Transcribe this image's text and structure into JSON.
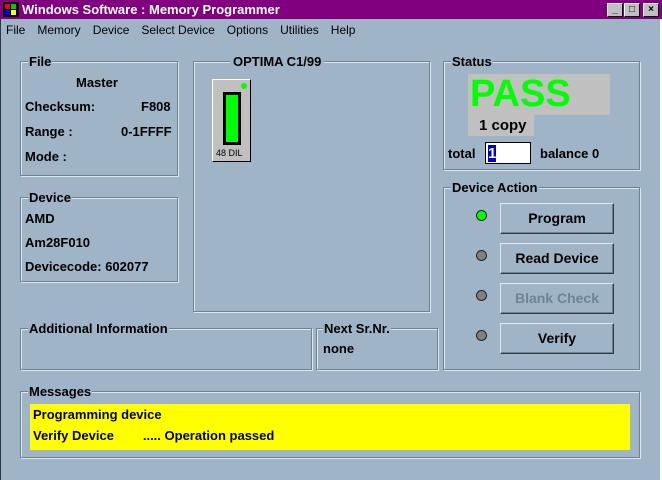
{
  "window": {
    "title": "Windows Software :  Memory Programmer",
    "minimize": "_",
    "maximize": "□",
    "close": "×"
  },
  "menu": [
    {
      "label": "File"
    },
    {
      "label": "Memory"
    },
    {
      "label": "Device"
    },
    {
      "label": "Select Device"
    },
    {
      "label": "Options"
    },
    {
      "label": "Utilities"
    },
    {
      "label": "Help"
    }
  ],
  "file": {
    "title": "File",
    "name": "Master",
    "checksum_label": "Checksum:",
    "checksum": "F808",
    "range_label": "Range :",
    "range": "0-1FFFF",
    "mode_label": "Mode :"
  },
  "device": {
    "title": "Device",
    "maker": "AMD",
    "part": "Am28F010",
    "devicecode": "Devicecode: 602077"
  },
  "programmer": {
    "title": "OPTIMA  C1/99",
    "socket": "48 DIL"
  },
  "additional": {
    "title": "Additional Information"
  },
  "next_sr": {
    "title": "Next Sr.Nr.",
    "value": "none"
  },
  "status": {
    "title": "Status",
    "result": "PASS",
    "copies": "1 copy",
    "total_label": "total",
    "total": "1",
    "balance": "balance 0",
    "pass_color": "#00ff00"
  },
  "actions": {
    "title": "Device Action",
    "buttons": [
      {
        "label": "Program",
        "led": "#00ff00",
        "enabled": true
      },
      {
        "label": "Read Device",
        "led": "#808080",
        "enabled": true
      },
      {
        "label": "Blank Check",
        "led": "#808080",
        "enabled": false
      },
      {
        "label": "Verify",
        "led": "#808080",
        "enabled": true
      }
    ]
  },
  "messages": {
    "title": "Messages",
    "lines": [
      "Programming device",
      "Verify Device        ..... Operation passed"
    ]
  }
}
